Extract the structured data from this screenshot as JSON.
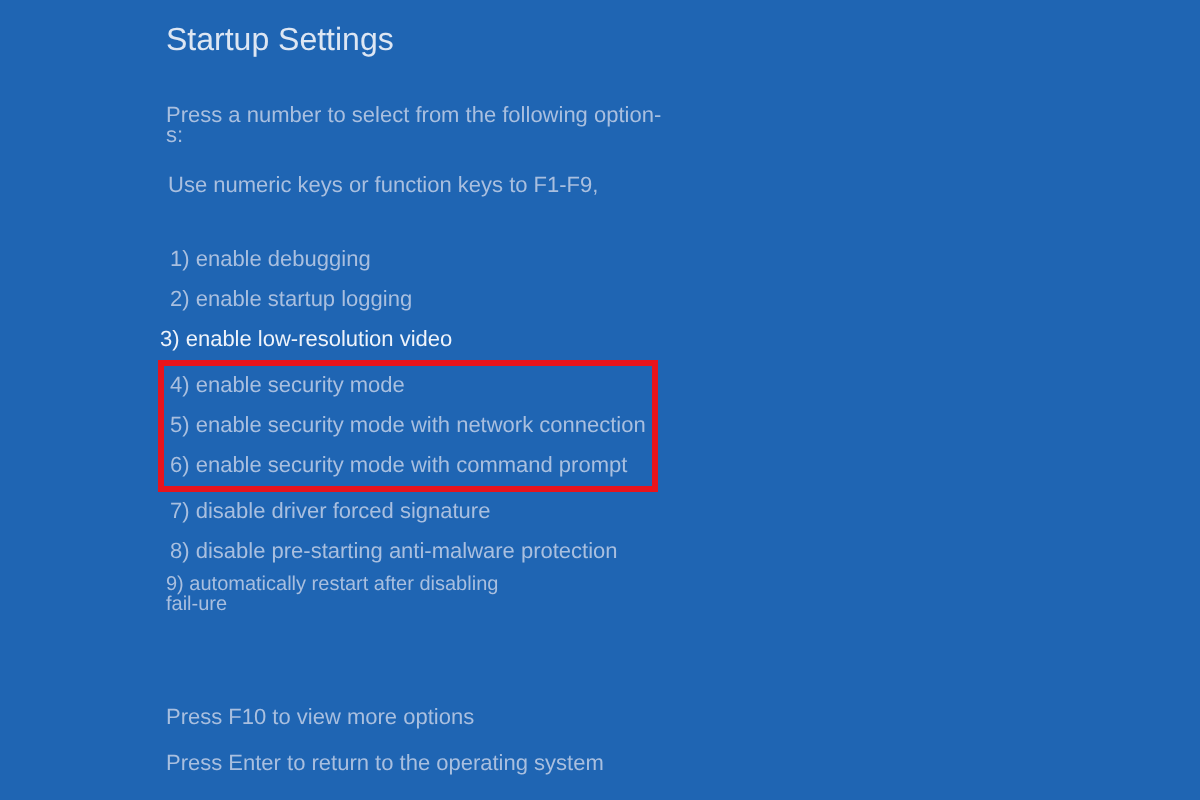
{
  "title": "Startup Settings",
  "intro": "Press a number to select from the following option-s:",
  "hint": "Use numeric keys or function keys to F1-F9,",
  "options": [
    {
      "label": "1) enable debugging",
      "selected": false,
      "boxed": false
    },
    {
      "label": "2) enable startup logging",
      "selected": false,
      "boxed": false
    },
    {
      "label": "3) enable low-resolution video",
      "selected": true,
      "boxed": false
    },
    {
      "label": "4) enable security mode",
      "selected": false,
      "boxed": true
    },
    {
      "label": "5) enable security mode with network connection",
      "selected": false,
      "boxed": true
    },
    {
      "label": "6) enable security mode with command prompt",
      "selected": false,
      "boxed": true
    },
    {
      "label": "7) disable driver forced signature",
      "selected": false,
      "boxed": false
    },
    {
      "label": "8) disable pre-starting anti-malware protection",
      "selected": false,
      "boxed": false
    },
    {
      "label": "9) automatically restart after disabling fail-ure",
      "selected": false,
      "boxed": false
    }
  ],
  "footer": [
    "Press F10 to view more options",
    "Press Enter to return to the operating system"
  ]
}
